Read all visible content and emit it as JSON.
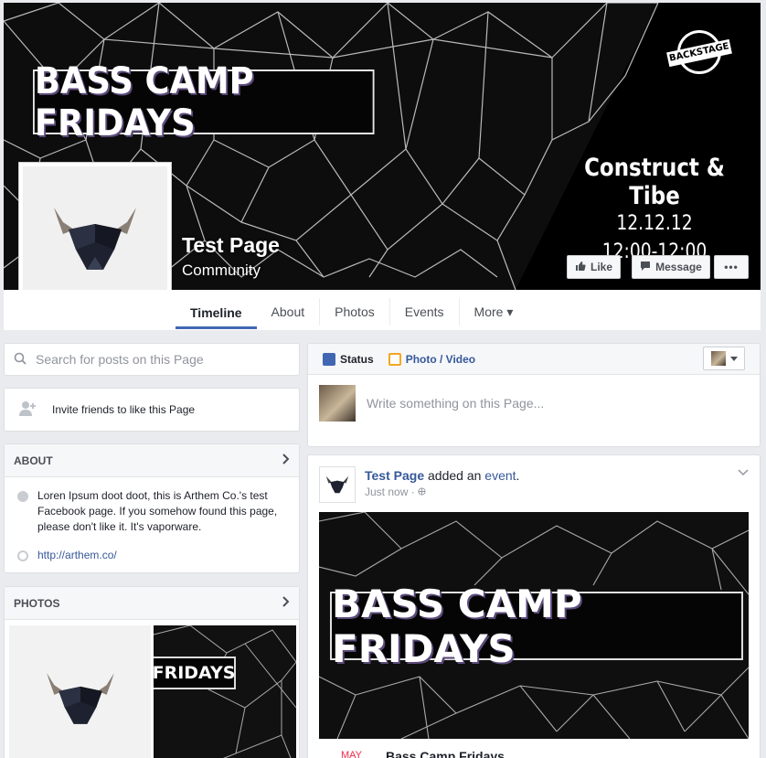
{
  "cover": {
    "banner_text": "BASS CAMP FRIDAYS",
    "brand_badge": "BACKSTAGE",
    "event_line1": "Construct & Tibe",
    "event_line2": "12.12.12",
    "event_line3": "12:00-12:00"
  },
  "page": {
    "name": "Test Page",
    "category": "Community"
  },
  "actions": {
    "like": "Like",
    "message": "Message",
    "more": "•••"
  },
  "tabs": [
    "Timeline",
    "About",
    "Photos",
    "Events",
    "More ▾"
  ],
  "left": {
    "search_placeholder": "Search for posts on this Page",
    "invite": "Invite friends to like this Page",
    "about": {
      "title": "ABOUT",
      "description": "Loren Ipsum doot doot, this is Arthem Co.'s test Facebook page. If you somehow found this page, please don't like it. It's vaporware.",
      "website": "http://arthem.co/"
    },
    "photos": {
      "title": "PHOTOS",
      "thumb_text": "FRIDAYS"
    }
  },
  "composer": {
    "status_tab": "Status",
    "photo_tab": "Photo / Video",
    "placeholder": "Write something on this Page..."
  },
  "post": {
    "author": "Test Page",
    "action_mid": " added an ",
    "action_link": "event",
    "action_end": ".",
    "time": "Just now · ",
    "banner_text": "BASS CAMP FRIDAYS",
    "event_month": "MAY",
    "event_title": "Bass Camp Fridays"
  },
  "colors": {
    "link": "#365899",
    "accent": "#4267b2",
    "cover_bg": "#0d0d0d"
  }
}
